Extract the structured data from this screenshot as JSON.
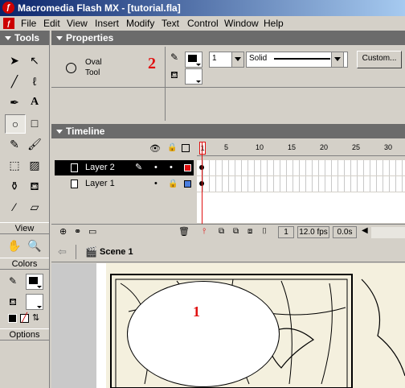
{
  "window": {
    "title": "Macromedia Flash MX - [tutorial.fla]"
  },
  "menu": [
    "File",
    "Edit",
    "View",
    "Insert",
    "Modify",
    "Text",
    "Control",
    "Window",
    "Help"
  ],
  "tools_panel": {
    "title": "Tools",
    "view_label": "View",
    "colors_label": "Colors",
    "options_label": "Options"
  },
  "properties": {
    "title": "Properties",
    "tool_name_line1": "Oval",
    "tool_name_line2": "Tool",
    "stroke_height": "1",
    "stroke_style": "Solid",
    "custom_button": "Custom...",
    "annotation": "2",
    "stroke_color": "#000000",
    "fill_color": "#ffffff"
  },
  "timeline": {
    "title": "Timeline",
    "frame_numbers": [
      "1",
      "5",
      "10",
      "15",
      "20",
      "25",
      "30"
    ],
    "layers": [
      {
        "name": "Layer 2",
        "selected": true
      },
      {
        "name": "Layer 1",
        "selected": false
      }
    ],
    "current_frame": "1",
    "fps": "12.0 fps",
    "time": "0.0s"
  },
  "stage": {
    "scene_name": "Scene 1",
    "annotation": "1"
  },
  "colors": {
    "accent": "#0a246a",
    "annotation_red": "#e01010"
  }
}
